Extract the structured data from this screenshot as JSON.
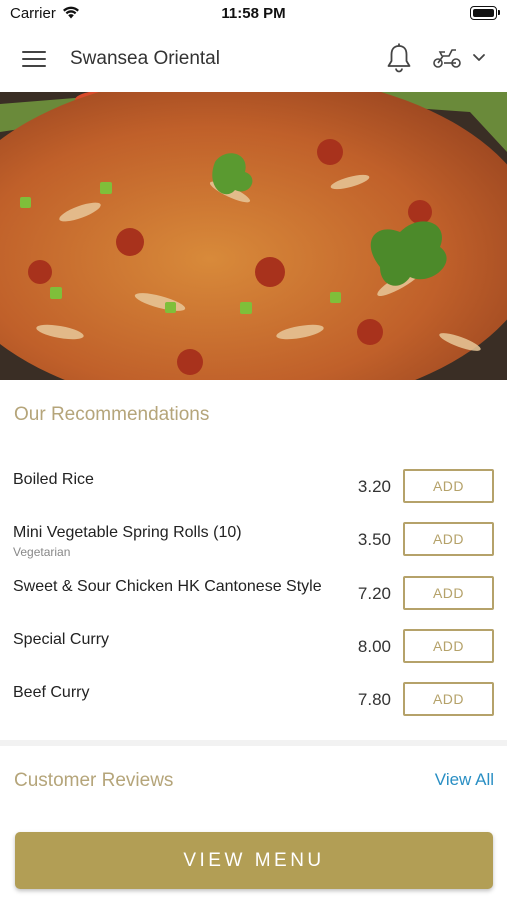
{
  "status_bar": {
    "carrier": "Carrier",
    "time": "11:58 PM"
  },
  "nav": {
    "title": "Swansea Oriental",
    "icons": [
      "menu-icon",
      "bell-icon",
      "scooter-icon",
      "chevron-down-icon"
    ]
  },
  "recommendations": {
    "title": "Our Recommendations",
    "items": [
      {
        "name": "Boiled Rice",
        "subtitle": "",
        "price": "3.20",
        "button": "ADD"
      },
      {
        "name": "Mini Vegetable Spring Rolls (10)",
        "subtitle": "Vegetarian",
        "price": "3.50",
        "button": "ADD"
      },
      {
        "name": "Sweet & Sour Chicken HK Cantonese Style",
        "subtitle": "",
        "price": "7.20",
        "button": "ADD"
      },
      {
        "name": "Special Curry",
        "subtitle": "",
        "price": "8.00",
        "button": "ADD"
      },
      {
        "name": "Beef Curry",
        "subtitle": "",
        "price": "7.80",
        "button": "ADD"
      }
    ]
  },
  "reviews": {
    "title": "Customer Reviews",
    "view_all": "View All"
  },
  "footer": {
    "view_menu": "VIEW MENU"
  },
  "colors": {
    "accent_gold": "#b29e55",
    "link_blue": "#2a8fc4",
    "section_title": "#b5a57a"
  }
}
